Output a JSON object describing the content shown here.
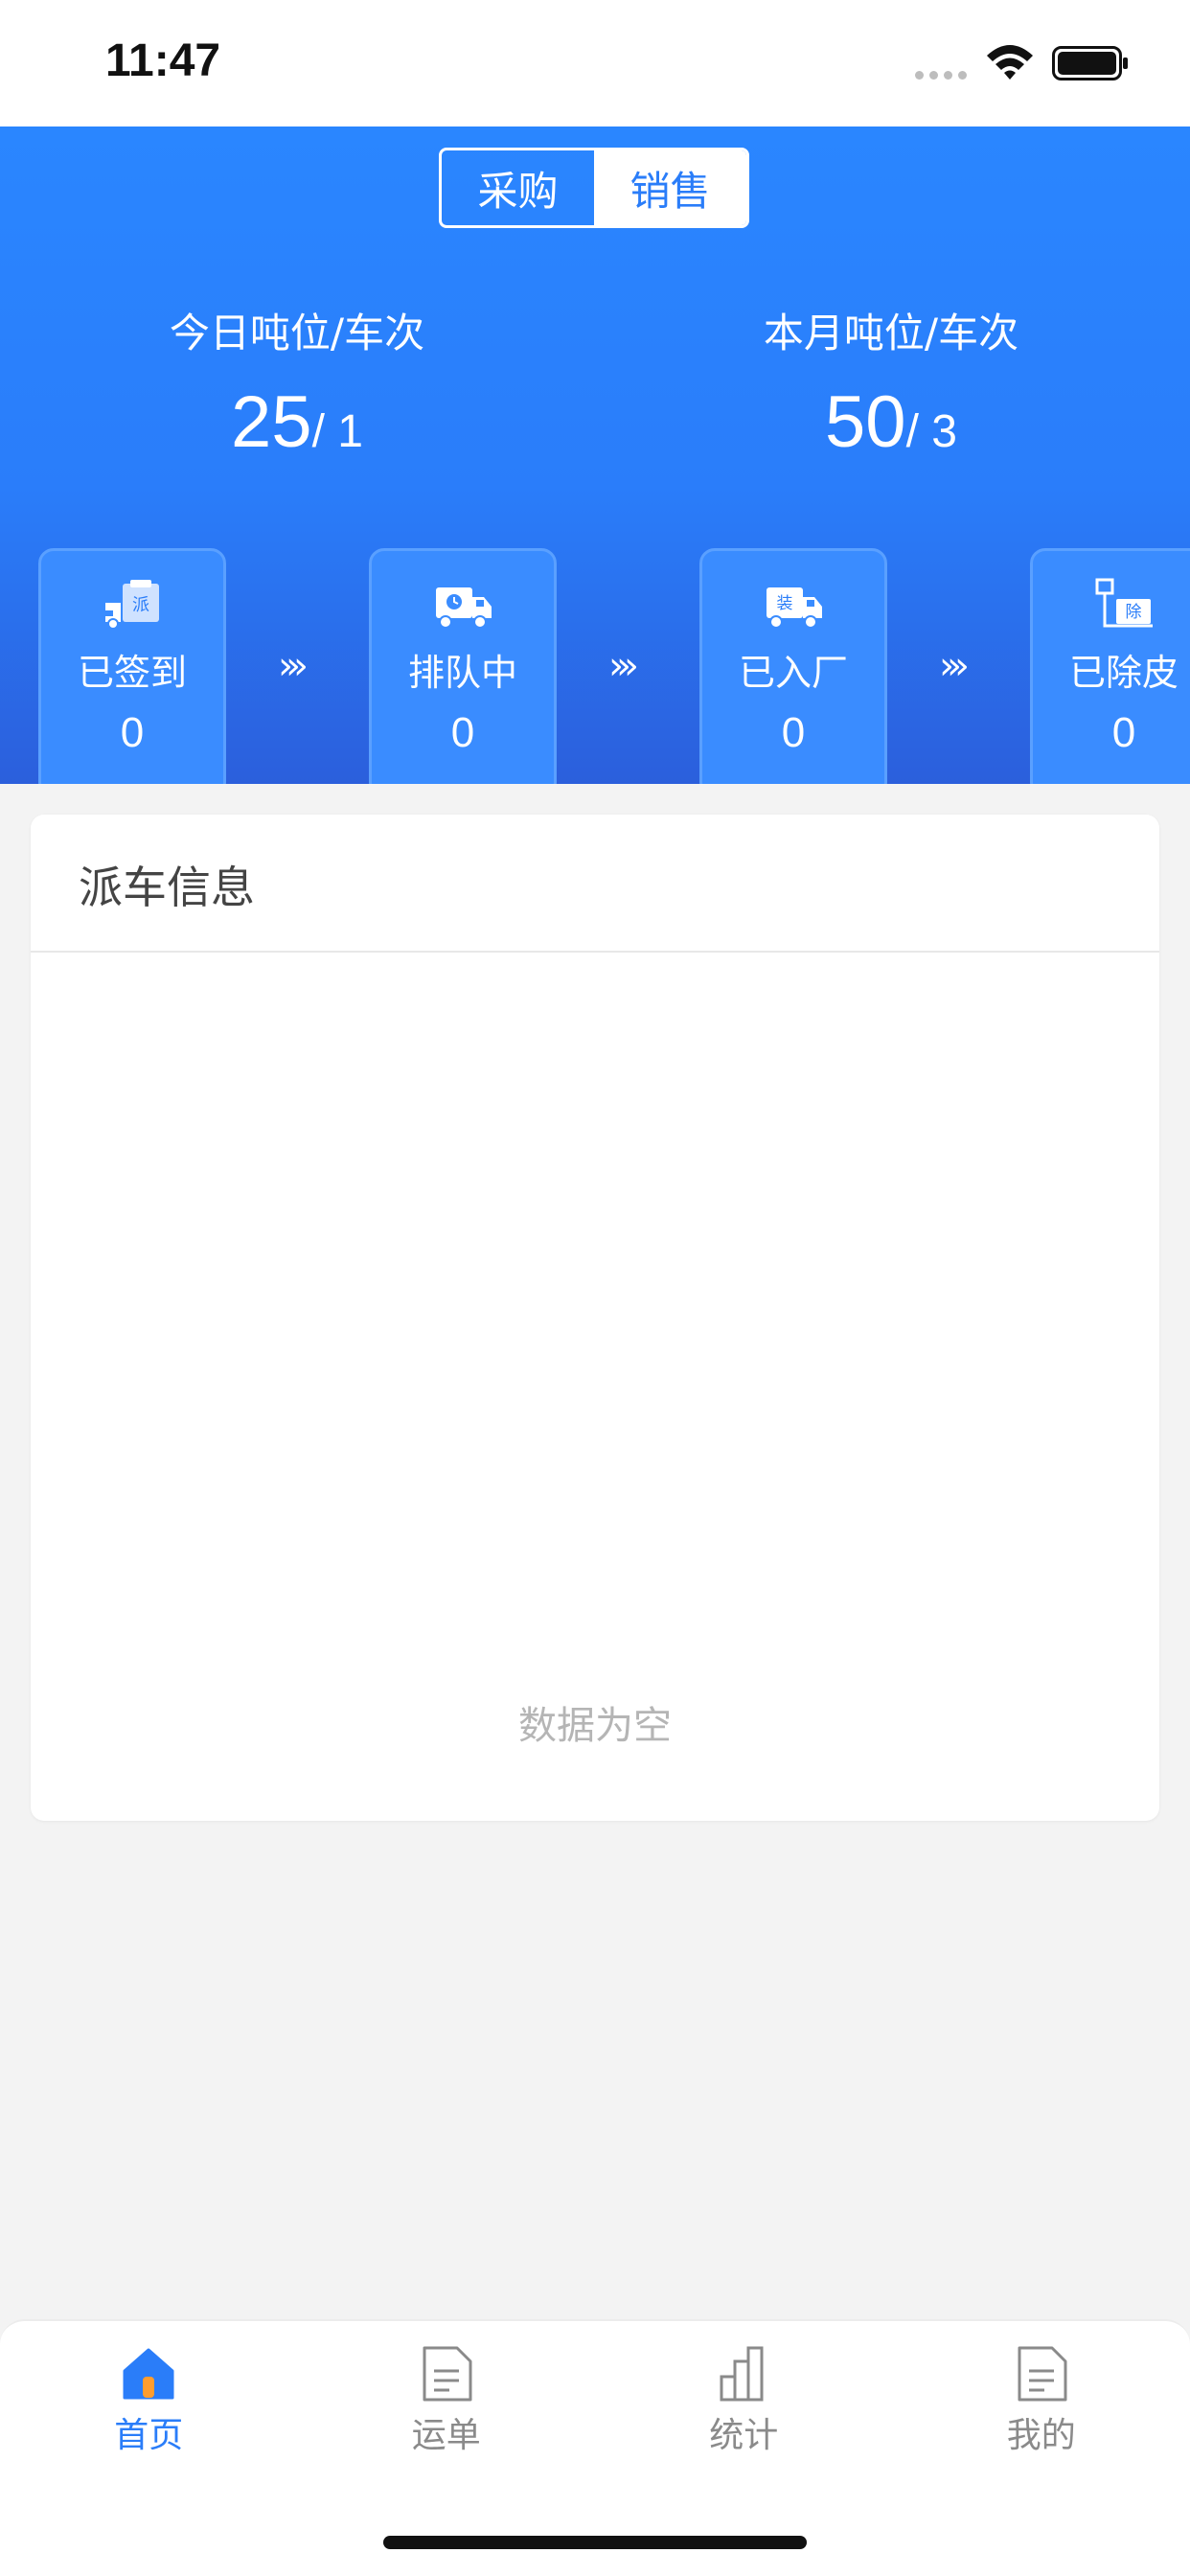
{
  "status_bar": {
    "time": "11:47"
  },
  "header": {
    "segments": [
      {
        "label": "采购",
        "active": false
      },
      {
        "label": "销售",
        "active": true
      }
    ],
    "today": {
      "label": "今日吨位/车次",
      "tons": "25",
      "trips": "/ 1"
    },
    "month": {
      "label": "本月吨位/车次",
      "tons": "50",
      "trips": "/ 3"
    },
    "stages": [
      {
        "label": "已签到",
        "count": "0",
        "icon": "dispatch-truck-icon",
        "badge": "派"
      },
      {
        "label": "排队中",
        "count": "0",
        "icon": "queue-truck-icon",
        "badge": ""
      },
      {
        "label": "已入厂",
        "count": "0",
        "icon": "load-truck-icon",
        "badge": "装"
      },
      {
        "label": "已除皮",
        "count": "0",
        "icon": "scale-icon",
        "badge": "除"
      }
    ],
    "arrow": "›››"
  },
  "dispatch": {
    "title": "派车信息",
    "empty_text": "数据为空"
  },
  "tabs": [
    {
      "label": "首页",
      "icon": "home-icon",
      "active": true
    },
    {
      "label": "运单",
      "icon": "waybill-icon",
      "active": false
    },
    {
      "label": "统计",
      "icon": "stats-icon",
      "active": false
    },
    {
      "label": "我的",
      "icon": "profile-doc-icon",
      "active": false
    }
  ],
  "colors": {
    "primary": "#2a7df9",
    "header_top": "#2a86ff",
    "header_bottom": "#2b5fdc",
    "empty_text": "#b5b5b5"
  }
}
